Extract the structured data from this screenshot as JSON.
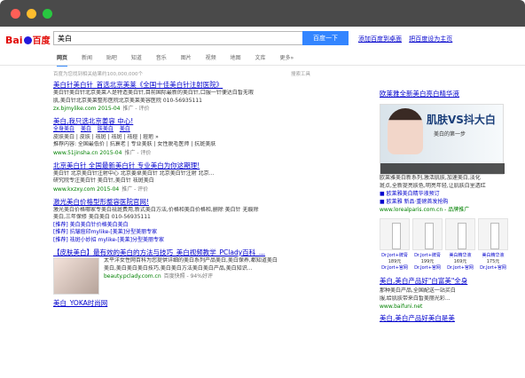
{
  "header": {
    "logo": {
      "bai": "Bai",
      "du": "du",
      "cn": "百度"
    },
    "search_value": "美白",
    "search_button": "百度一下",
    "links": [
      "添加百度到桌面",
      "把百度设为主页"
    ]
  },
  "tabs": [
    "网页",
    "新闻",
    "贴吧",
    "知道",
    "音乐",
    "图片",
    "视频",
    "地图",
    "文库",
    "更多»"
  ],
  "stats": {
    "text": "百度为您找到相关结果约100,000,000个",
    "tool": "搜索工具"
  },
  "results": [
    {
      "title": "美白针美白针_首选北京美莱《全国十佳美白针注射医院》",
      "desc": [
        "美白针美白针北京美莱人是特造美白针,目前国际最新的美白针,口服一针便达白皙无瑕",
        "肌,美白针北京美莱整形医院北京美莱美容医院 010-56935111"
      ],
      "url": "zx.bjmylike.com 2015-04",
      "extra": "推广 - 评价"
    },
    {
      "title": "美白,我只选北京姜容 中心!",
      "desc": [
        "皮肤美白 | 皮肤 | 祛斑 | 祛斑 | 祛痘 | 痘疤 »",
        "推荐内容: 全国最低价 | 抗衰老 | 专业美肤 | 女性脱毛医师 | 抗斑美肤",
        "www.51jinsha.cn 2015-04"
      ],
      "url": "www.51jinsha.cn 2015-04",
      "extra": "推广 - 评价",
      "sub": [
        "全身美白",
        "美白",
        "肤美白",
        "美白"
      ]
    },
    {
      "title": "北京美白针 全国最新美白针  专业美白为你这期理!",
      "desc": [
        "美白针 北京美白针注射中心 北京姜卓美白针 北京美白针注射 北京...",
        "研究院专注美白针 美白针,美白针 祛斑美白"
      ],
      "url": "www.kxzxy.com 2015-04",
      "extra": "推广 - 评价"
    },
    {
      "title": "激光美白价格型形整容医院官网!",
      "desc": [
        "激光美白价格哪家专美白祛斑费用,新式美白方法,价格和美白价格和,删除 美白针 无痕除",
        "美白,三年保修 美白美白 010-56935111"
      ],
      "url": "",
      "extra": "",
      "sub": [
        "[推荐] 美白美白针价格美白美白",
        "[推荐] 抗皱痘印mylike-[美莱]分型美丽专家",
        "[推荐] 祛斑小妙招 mylike-[美莱]分型美丽专家"
      ]
    },
    {
      "title": "【皮肤美白】最有效的美白的方法与技巧_美白视频教学_PClady百科_...",
      "desc": [
        "太平洋女性网百科为您提供详细的美白系列产品美白,美白保养,都知道美白",
        "美白,美白美白美白技巧,美白美白方法美白美白产品,美白知识..."
      ],
      "url": "beauty.pclady.com.cn",
      "extra": "百度快照 - 94%好评"
    },
    {
      "title": "美白_YOKA时尚网",
      "desc": [],
      "url": "",
      "extra": ""
    }
  ],
  "sidebar": {
    "ad_title": "欧莱雅全新美白亮白精华液",
    "ad_heading": "肌肤VS抖大白",
    "ad_sub": "美白的第一步",
    "desc": [
      "欧莱雅美白新系列,激活肌肤,加速美白,淡化",
      "斑点,全新提亮肤色,明亮年轻,让肌肤白里透红"
    ],
    "links": [
      "■ 欧莱雅美白精华液预订",
      "■ 欧莱雅 新品·重磅首发抢购"
    ],
    "url": "www.lorealparis.com.cn - 品牌推广",
    "products": [
      {
        "name": "Dr.Jort+牌膏",
        "price": "189元",
        "link": "Dr.Jort+官网"
      },
      {
        "name": "Dr.Jort+牌膏",
        "price": "199元",
        "link": "Dr.Jort+官网"
      },
      {
        "name": "美白精华液",
        "price": "169元",
        "link": "Dr.Jort+官网"
      },
      {
        "name": "美白精华液",
        "price": "175元",
        "link": "Dr.Jort+官网"
      }
    ],
    "ad2_title": "美白,美白产品好\"白富美\"全身",
    "ad2_desc": [
      "那种美白产品,全国配送一站买白",
      "服,给肌肤带来白皙美丽光彩..."
    ],
    "ad2_url": "www.baifuni.net",
    "ad3_title": "美白,美白产品好美白是美"
  }
}
